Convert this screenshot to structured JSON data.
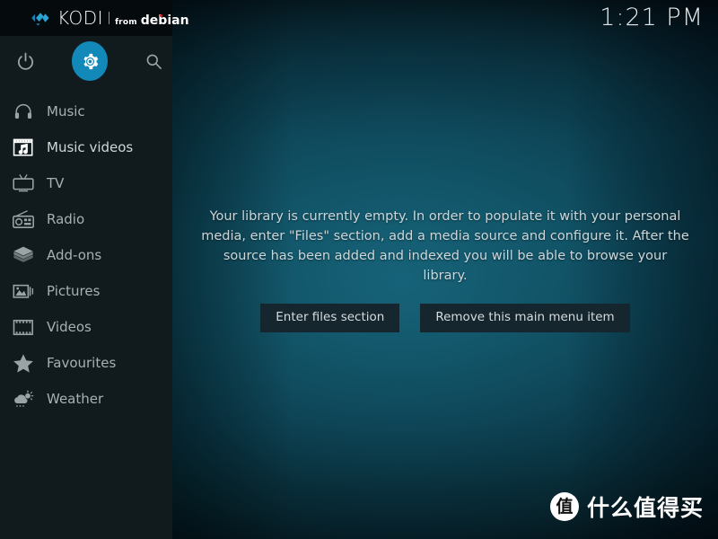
{
  "app": {
    "name": "Kodi",
    "logo": {
      "mark_icon": "kodi-diamond-icon",
      "brand": "KODI",
      "from_label": "from",
      "distro": "debian",
      "mark_color": "#2aa3d4",
      "accent_dot_color": "#d7241b"
    }
  },
  "header": {
    "clock": "1:21 PM"
  },
  "sidebar": {
    "background": "#111b1e",
    "accent_color": "#1289b8",
    "icon_buttons": [
      {
        "name": "power-icon",
        "label": "Power",
        "active": false
      },
      {
        "name": "gear-icon",
        "label": "Settings",
        "active": true
      },
      {
        "name": "search-icon",
        "label": "Search",
        "active": false
      }
    ],
    "items": [
      {
        "label": "Music",
        "icon": "headphones-icon",
        "selected": false
      },
      {
        "label": "Music videos",
        "icon": "music-video-icon",
        "selected": true
      },
      {
        "label": "TV",
        "icon": "television-icon",
        "selected": false
      },
      {
        "label": "Radio",
        "icon": "radio-icon",
        "selected": false
      },
      {
        "label": "Add-ons",
        "icon": "box-icon",
        "selected": false
      },
      {
        "label": "Pictures",
        "icon": "photo-icon",
        "selected": false
      },
      {
        "label": "Videos",
        "icon": "filmstrip-icon",
        "selected": false
      },
      {
        "label": "Favourites",
        "icon": "star-icon",
        "selected": false
      },
      {
        "label": "Weather",
        "icon": "cloud-sun-icon",
        "selected": false
      }
    ]
  },
  "main": {
    "empty_message": "Your library is currently empty. In order to populate it with your personal media, enter \"Files\" section, add a media source and configure it. After the source has been added and indexed you will be able to browse your library.",
    "buttons": [
      {
        "label": "Enter files section"
      },
      {
        "label": "Remove this main menu item"
      }
    ],
    "background_top": "#02070a",
    "background_mid": "#0d4c5d",
    "background_bottom": "#010609"
  },
  "watermark": {
    "badge_char": "值",
    "text": "什么值得买"
  }
}
